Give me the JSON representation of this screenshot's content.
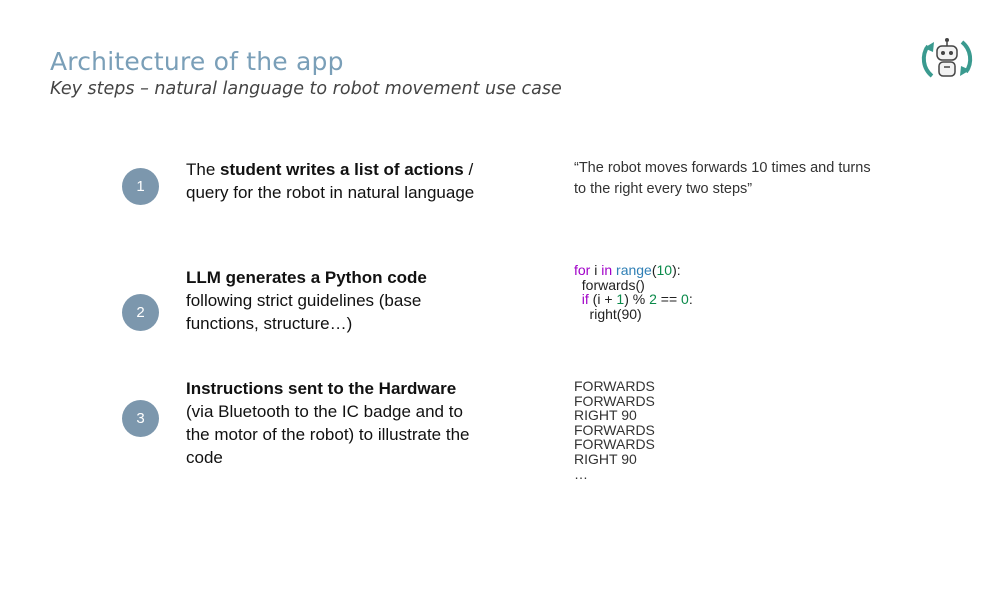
{
  "header": {
    "title": "Architecture of the app",
    "subtitle": "Key steps – natural language to robot movement use case"
  },
  "logo": {
    "icon": "robot-refresh-icon",
    "color": "#3a9a8f"
  },
  "steps": [
    {
      "number": "1",
      "bold": "student writes a list of actions",
      "pre": "The ",
      "post": " / query for the robot in natural language"
    },
    {
      "number": "2",
      "bold": "LLM generates a Python code",
      "pre": "",
      "post": " following strict guidelines (base functions, structure…)"
    },
    {
      "number": "3",
      "bold": "Instructions sent to the Hardware",
      "pre": "",
      "post": " (via Bluetooth to the IC badge and to the motor of the robot) to illustrate the code"
    }
  ],
  "examples": {
    "quote": "“The robot moves forwards 10 times and turns to the right every two steps”",
    "code": {
      "line1": {
        "kw1": "for",
        "var": " i ",
        "kw2": "in",
        "fn": " range",
        "open": "(",
        "num": "10",
        "close": "):"
      },
      "line2": "  forwards()",
      "line3": {
        "indent": "  ",
        "kw": "if",
        "a": " (i + ",
        "n1": "1",
        "b": ") % ",
        "n2": "2",
        "c": " == ",
        "n3": "0",
        "d": ":"
      },
      "line4": "    right(90)"
    },
    "commands": [
      "FORWARDS",
      "FORWARDS",
      "RIGHT 90",
      "FORWARDS",
      "FORWARDS",
      "RIGHT 90",
      "…"
    ]
  },
  "colors": {
    "badge": "#7c97ad",
    "title": "#7a9fb8",
    "keyword": "#a000c8",
    "function": "#2f7fb5",
    "number": "#0a8a4a"
  }
}
